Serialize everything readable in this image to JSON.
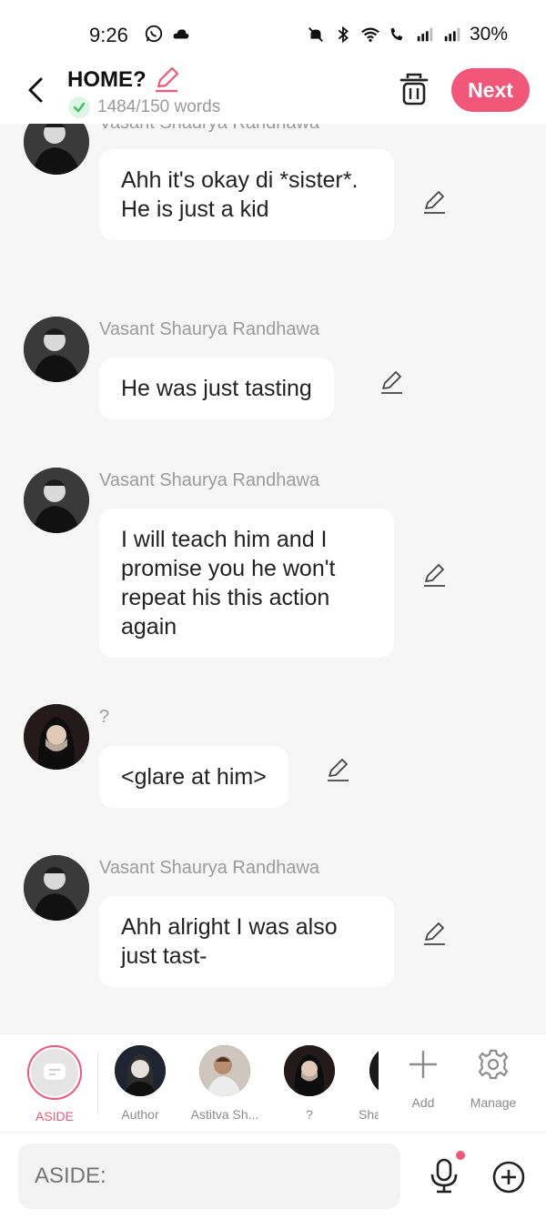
{
  "status": {
    "time": "9:26",
    "battery": "30%"
  },
  "header": {
    "title": "HOME?",
    "word_count": "1484/150 words",
    "next_label": "Next"
  },
  "messages": [
    {
      "sender": "Vasant Shaurya Randhawa",
      "text": "Ahh it's okay di *sister*. He is just a kid"
    },
    {
      "sender": "Vasant Shaurya Randhawa",
      "text": "He was just tasting"
    },
    {
      "sender": "Vasant Shaurya Randhawa",
      "text": "I will teach him and I promise you he won't repeat his this action again"
    },
    {
      "sender": "?",
      "text": "<glare at him>"
    },
    {
      "sender": "Vasant Shaurya Randhawa",
      "text": "Ahh alright I was also just tast-"
    }
  ],
  "characters": [
    {
      "label": "ASIDE"
    },
    {
      "label": "Author"
    },
    {
      "label": "Astitva Sh..."
    },
    {
      "label": "?"
    },
    {
      "label": "Sha"
    },
    {
      "label": "Add"
    },
    {
      "label": "Manage"
    }
  ],
  "input": {
    "placeholder": "ASIDE:"
  },
  "colors": {
    "accent": "#f2577a",
    "background": "#f6f6f6",
    "bubble": "#ffffff"
  }
}
